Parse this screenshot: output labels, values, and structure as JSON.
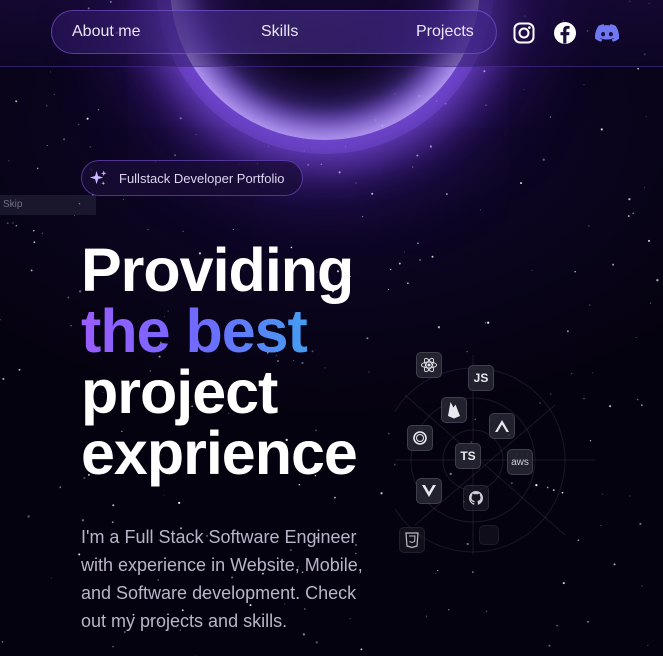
{
  "nav": {
    "links": [
      {
        "label": "About me"
      },
      {
        "label": "Skills"
      },
      {
        "label": "Projects"
      }
    ],
    "socials": [
      "instagram-icon",
      "facebook-icon",
      "discord-icon"
    ]
  },
  "hero": {
    "badge": "Fullstack Developer Portfolio",
    "skip_label": "Skip",
    "headline": {
      "line1": "Providing",
      "line2": "the best",
      "line3": "project",
      "line4": "exprience"
    },
    "description": "I'm a Full Stack Software Engineer with experience in Website, Mobile, and Software development. Check out my projects and skills."
  },
  "tech_icons": {
    "js": "JS",
    "ts": "TS",
    "aws": "aws",
    "icons": [
      "react-icon",
      "js-icon",
      "firebase-icon",
      "tailwind-icon",
      "ts-icon",
      "aws-icon",
      "threejs-icon",
      "vue-icon",
      "github-icon",
      "css-icon",
      "html-icon"
    ]
  },
  "colors": {
    "background": "#05020f",
    "accent_purple": "#9b5cff",
    "accent_cyan": "#2fb6e8",
    "text": "#ffffff"
  }
}
